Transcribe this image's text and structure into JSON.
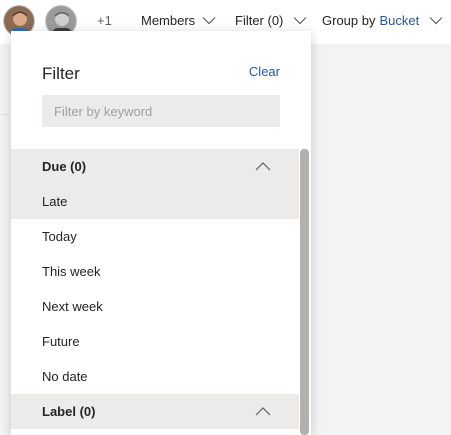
{
  "toolbar": {
    "more_members": "+1",
    "members_label": "Members",
    "filter_label": "Filter (0)",
    "group_by_label": "Group by",
    "group_by_value": "Bucket"
  },
  "filter_panel": {
    "title": "Filter",
    "clear_label": "Clear",
    "search_placeholder": "Filter by keyword",
    "groups": [
      {
        "label": "Due (0)",
        "options": [
          "Late",
          "Today",
          "This week",
          "Next week",
          "Future",
          "No date"
        ]
      },
      {
        "label": "Label (0)",
        "options": []
      }
    ],
    "highlighted_option": "Late"
  },
  "colors": {
    "accent": "#2b579a",
    "panel_header_bg": "#edebe9",
    "scrollbar": "#b3b0ad"
  },
  "icons": {
    "chevron": "chevron-down-icon",
    "collapse": "chevron-up-icon"
  }
}
